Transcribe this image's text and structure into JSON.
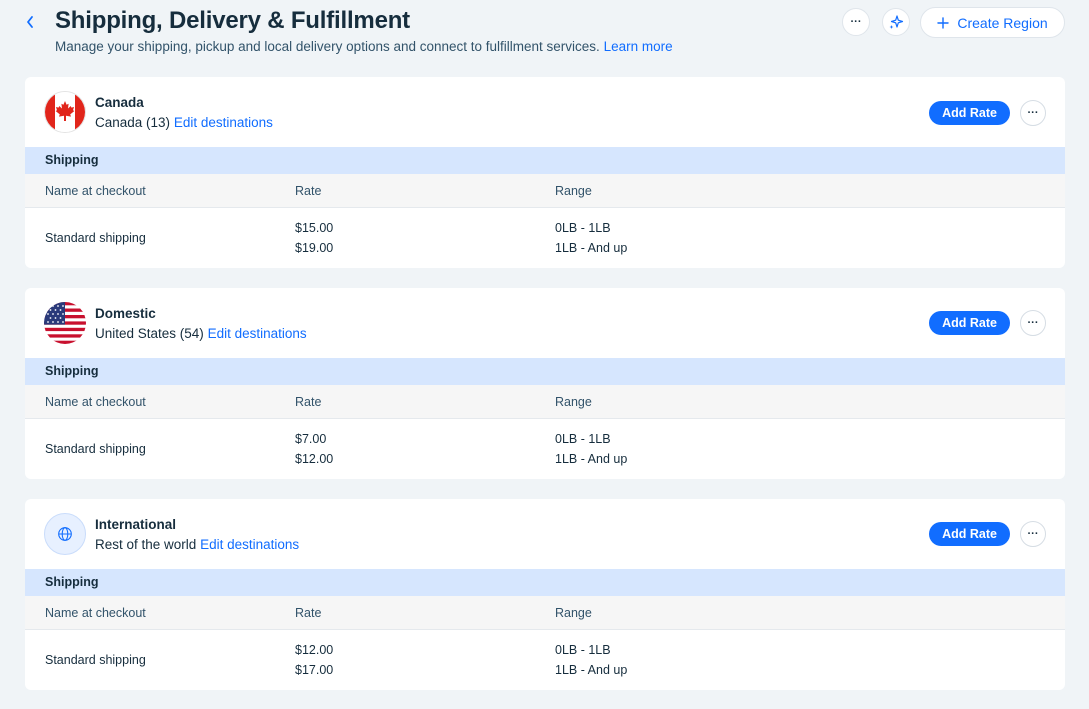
{
  "header": {
    "title": "Shipping, Delivery & Fulfillment",
    "subtitle": "Manage your shipping, pickup and local delivery options and connect to fulfillment services.",
    "learn_more": "Learn more",
    "create_region_label": "Create Region"
  },
  "labels": {
    "add_rate": "Add Rate",
    "edit_destinations": "Edit destinations",
    "more": "···",
    "section": "Shipping",
    "col_name": "Name at checkout",
    "col_rate": "Rate",
    "col_range": "Range"
  },
  "regions": [
    {
      "name": "Canada",
      "destinations": "Canada (13)",
      "icon": "canada-flag-icon",
      "rate_name": "Standard shipping",
      "rates": [
        "$15.00",
        "$19.00"
      ],
      "ranges": [
        "0LB - 1LB",
        "1LB - And up"
      ]
    },
    {
      "name": "Domestic",
      "destinations": "United States (54)",
      "icon": "us-flag-icon",
      "rate_name": "Standard shipping",
      "rates": [
        "$7.00",
        "$12.00"
      ],
      "ranges": [
        "0LB - 1LB",
        "1LB - And up"
      ]
    },
    {
      "name": "International",
      "destinations": "Rest of the world",
      "icon": "globe-icon",
      "rate_name": "Standard shipping",
      "rates": [
        "$12.00",
        "$17.00"
      ],
      "ranges": [
        "0LB - 1LB",
        "1LB - And up"
      ]
    }
  ],
  "colors": {
    "accent": "#116dff",
    "page_bg": "#f0f4f7",
    "section_bar": "#d6e6fe",
    "text": "#162d3d"
  }
}
